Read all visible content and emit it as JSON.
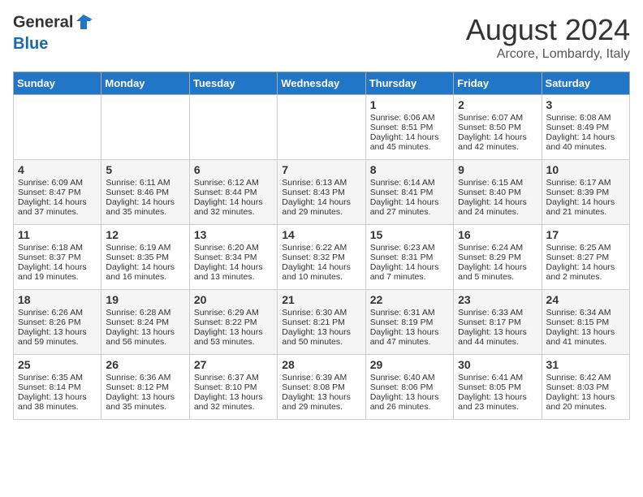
{
  "header": {
    "logo_general": "General",
    "logo_blue": "Blue",
    "month": "August 2024",
    "location": "Arcore, Lombardy, Italy"
  },
  "days_of_week": [
    "Sunday",
    "Monday",
    "Tuesday",
    "Wednesday",
    "Thursday",
    "Friday",
    "Saturday"
  ],
  "weeks": [
    [
      {
        "day": "",
        "info": ""
      },
      {
        "day": "",
        "info": ""
      },
      {
        "day": "",
        "info": ""
      },
      {
        "day": "",
        "info": ""
      },
      {
        "day": "1",
        "info": "Sunrise: 6:06 AM\nSunset: 8:51 PM\nDaylight: 14 hours and 45 minutes."
      },
      {
        "day": "2",
        "info": "Sunrise: 6:07 AM\nSunset: 8:50 PM\nDaylight: 14 hours and 42 minutes."
      },
      {
        "day": "3",
        "info": "Sunrise: 6:08 AM\nSunset: 8:49 PM\nDaylight: 14 hours and 40 minutes."
      }
    ],
    [
      {
        "day": "4",
        "info": "Sunrise: 6:09 AM\nSunset: 8:47 PM\nDaylight: 14 hours and 37 minutes."
      },
      {
        "day": "5",
        "info": "Sunrise: 6:11 AM\nSunset: 8:46 PM\nDaylight: 14 hours and 35 minutes."
      },
      {
        "day": "6",
        "info": "Sunrise: 6:12 AM\nSunset: 8:44 PM\nDaylight: 14 hours and 32 minutes."
      },
      {
        "day": "7",
        "info": "Sunrise: 6:13 AM\nSunset: 8:43 PM\nDaylight: 14 hours and 29 minutes."
      },
      {
        "day": "8",
        "info": "Sunrise: 6:14 AM\nSunset: 8:41 PM\nDaylight: 14 hours and 27 minutes."
      },
      {
        "day": "9",
        "info": "Sunrise: 6:15 AM\nSunset: 8:40 PM\nDaylight: 14 hours and 24 minutes."
      },
      {
        "day": "10",
        "info": "Sunrise: 6:17 AM\nSunset: 8:39 PM\nDaylight: 14 hours and 21 minutes."
      }
    ],
    [
      {
        "day": "11",
        "info": "Sunrise: 6:18 AM\nSunset: 8:37 PM\nDaylight: 14 hours and 19 minutes."
      },
      {
        "day": "12",
        "info": "Sunrise: 6:19 AM\nSunset: 8:35 PM\nDaylight: 14 hours and 16 minutes."
      },
      {
        "day": "13",
        "info": "Sunrise: 6:20 AM\nSunset: 8:34 PM\nDaylight: 14 hours and 13 minutes."
      },
      {
        "day": "14",
        "info": "Sunrise: 6:22 AM\nSunset: 8:32 PM\nDaylight: 14 hours and 10 minutes."
      },
      {
        "day": "15",
        "info": "Sunrise: 6:23 AM\nSunset: 8:31 PM\nDaylight: 14 hours and 7 minutes."
      },
      {
        "day": "16",
        "info": "Sunrise: 6:24 AM\nSunset: 8:29 PM\nDaylight: 14 hours and 5 minutes."
      },
      {
        "day": "17",
        "info": "Sunrise: 6:25 AM\nSunset: 8:27 PM\nDaylight: 14 hours and 2 minutes."
      }
    ],
    [
      {
        "day": "18",
        "info": "Sunrise: 6:26 AM\nSunset: 8:26 PM\nDaylight: 13 hours and 59 minutes."
      },
      {
        "day": "19",
        "info": "Sunrise: 6:28 AM\nSunset: 8:24 PM\nDaylight: 13 hours and 56 minutes."
      },
      {
        "day": "20",
        "info": "Sunrise: 6:29 AM\nSunset: 8:22 PM\nDaylight: 13 hours and 53 minutes."
      },
      {
        "day": "21",
        "info": "Sunrise: 6:30 AM\nSunset: 8:21 PM\nDaylight: 13 hours and 50 minutes."
      },
      {
        "day": "22",
        "info": "Sunrise: 6:31 AM\nSunset: 8:19 PM\nDaylight: 13 hours and 47 minutes."
      },
      {
        "day": "23",
        "info": "Sunrise: 6:33 AM\nSunset: 8:17 PM\nDaylight: 13 hours and 44 minutes."
      },
      {
        "day": "24",
        "info": "Sunrise: 6:34 AM\nSunset: 8:15 PM\nDaylight: 13 hours and 41 minutes."
      }
    ],
    [
      {
        "day": "25",
        "info": "Sunrise: 6:35 AM\nSunset: 8:14 PM\nDaylight: 13 hours and 38 minutes."
      },
      {
        "day": "26",
        "info": "Sunrise: 6:36 AM\nSunset: 8:12 PM\nDaylight: 13 hours and 35 minutes."
      },
      {
        "day": "27",
        "info": "Sunrise: 6:37 AM\nSunset: 8:10 PM\nDaylight: 13 hours and 32 minutes."
      },
      {
        "day": "28",
        "info": "Sunrise: 6:39 AM\nSunset: 8:08 PM\nDaylight: 13 hours and 29 minutes."
      },
      {
        "day": "29",
        "info": "Sunrise: 6:40 AM\nSunset: 8:06 PM\nDaylight: 13 hours and 26 minutes."
      },
      {
        "day": "30",
        "info": "Sunrise: 6:41 AM\nSunset: 8:05 PM\nDaylight: 13 hours and 23 minutes."
      },
      {
        "day": "31",
        "info": "Sunrise: 6:42 AM\nSunset: 8:03 PM\nDaylight: 13 hours and 20 minutes."
      }
    ]
  ]
}
